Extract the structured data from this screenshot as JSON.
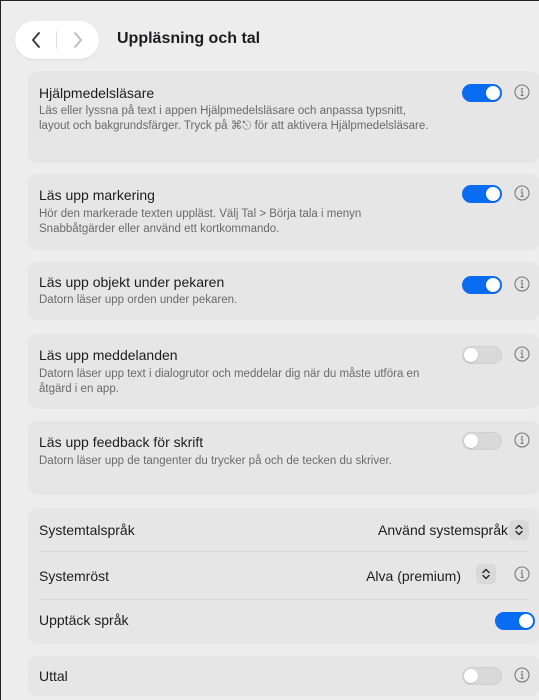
{
  "header": {
    "title": "Uppläsning och tal",
    "back_label": "Tillbaka",
    "forward_label": "Framåt"
  },
  "rows": [
    {
      "title": "Hjälpmedelsläsare",
      "description": "Läs eller lyssna på text i appen Hjälpmedelsläsare och anpassa typsnitt, layout och bakgrundsfärger. Tryck på ⌘⎋ för att aktivera Hjälpmedelsläsare.",
      "enabled": true
    },
    {
      "title": "Läs upp markering",
      "description": "Hör den markerade texten uppläst. Välj Tal > Börja tala i menyn Snabbåtgärder eller använd ett kortkommando.",
      "enabled": true
    },
    {
      "title": "Läs upp objekt under pekaren",
      "description": "Datorn läser upp orden under pekaren.",
      "enabled": true
    },
    {
      "title": "Läs upp meddelanden",
      "description": "Datorn läser upp text i dialogrutor och meddelar dig när du måste utföra en åtgärd i en app.",
      "enabled": false
    },
    {
      "title": "Läs upp feedback för skrift",
      "description": "Datorn läser upp de tangenter du trycker på och de tecken du skriver.",
      "enabled": false
    }
  ],
  "system": {
    "language_label": "Systemtalspråk",
    "language_value": "Använd systemspråk",
    "voice_label": "Systemröst",
    "voice_value": "Alva (premium)",
    "detect_label": "Upptäck språk",
    "detect_enabled": true
  },
  "pronunciation": {
    "label": "Uttal",
    "enabled": false
  },
  "colors": {
    "accent": "#0a6cf2",
    "card_bg": "#e6e6e6",
    "window_bg": "#ededed"
  }
}
